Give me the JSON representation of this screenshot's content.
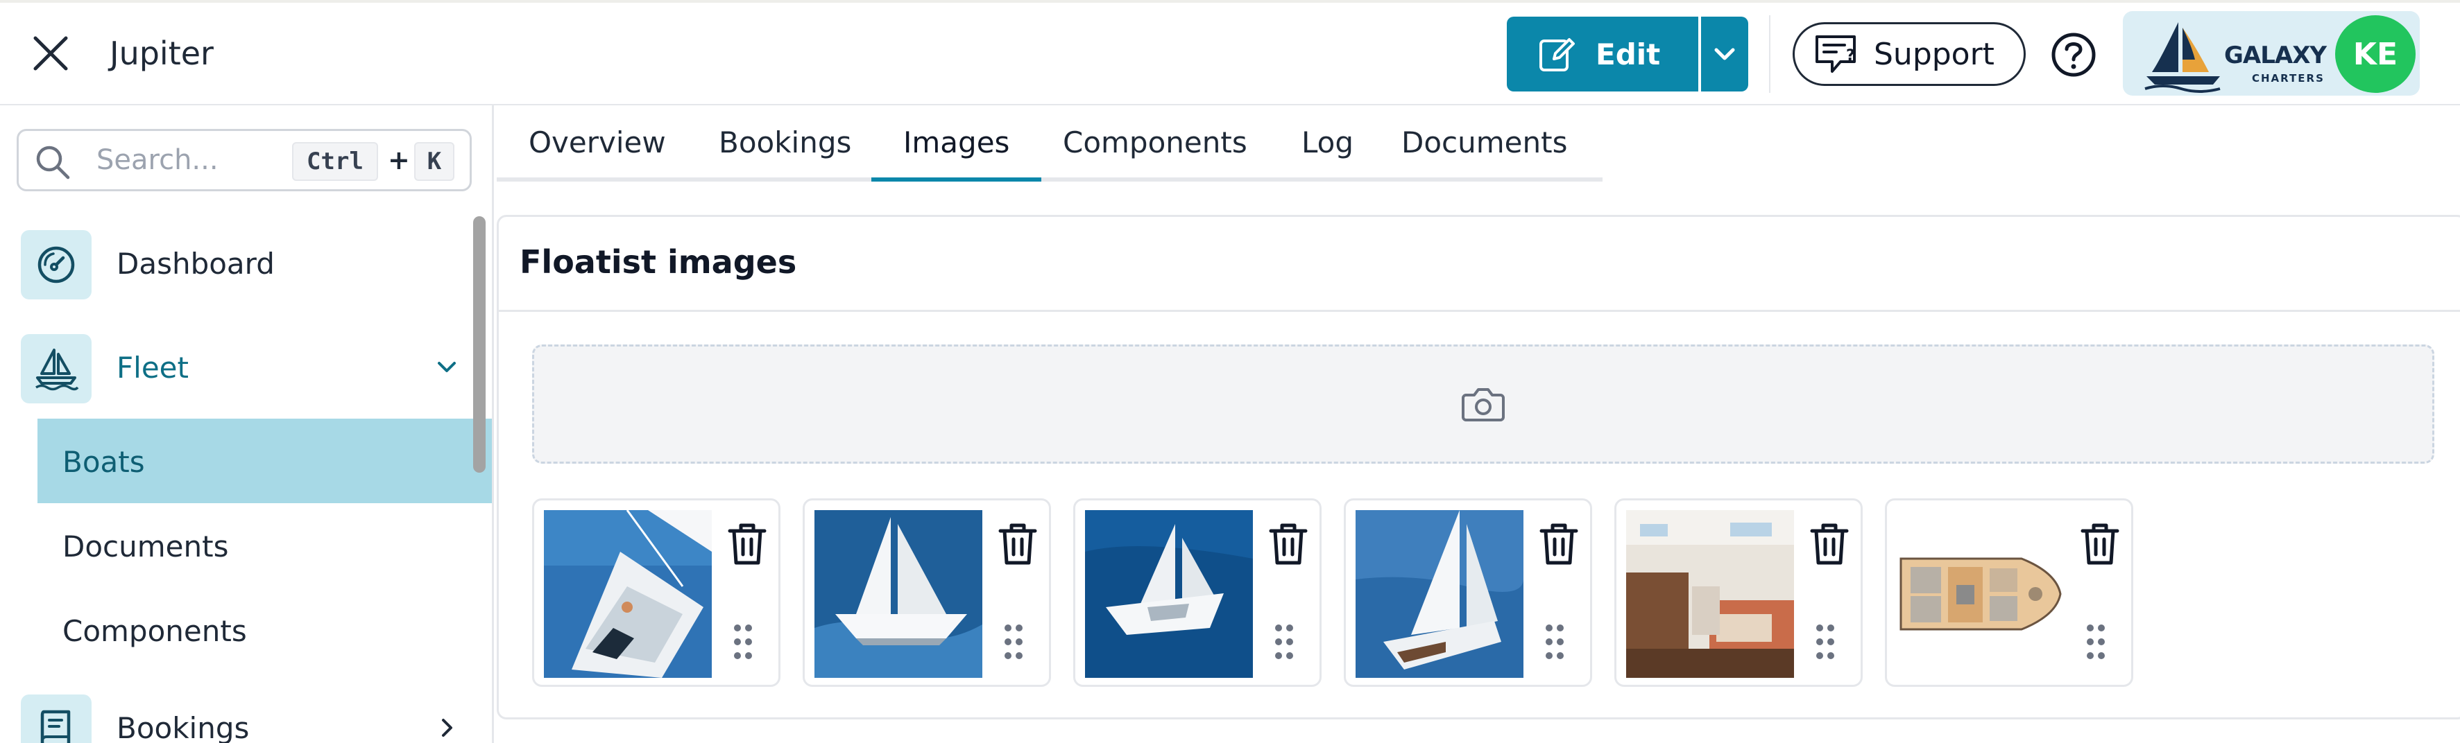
{
  "header": {
    "title": "Jupiter",
    "edit_label": "Edit",
    "support_label": "Support",
    "brand": {
      "name": "GALAXY",
      "sub": "CHARTERS"
    },
    "avatar_initials": "KE"
  },
  "sidebar": {
    "search": {
      "placeholder": "Search...",
      "shortcut_ctrl": "Ctrl",
      "shortcut_plus": "+",
      "shortcut_key": "K"
    },
    "items": [
      {
        "label": "Dashboard",
        "icon": "gauge-icon"
      },
      {
        "label": "Fleet",
        "icon": "sailboat-icon",
        "expanded": true,
        "children": [
          {
            "label": "Boats",
            "active": true
          },
          {
            "label": "Documents"
          },
          {
            "label": "Components"
          }
        ]
      },
      {
        "label": "Bookings",
        "icon": "book-icon",
        "expanded": false
      }
    ]
  },
  "tabs": [
    {
      "label": "Overview"
    },
    {
      "label": "Bookings"
    },
    {
      "label": "Images",
      "active": true
    },
    {
      "label": "Components"
    },
    {
      "label": "Log"
    },
    {
      "label": "Documents"
    }
  ],
  "card": {
    "title": "Floatist images",
    "upload_icon": "camera-icon",
    "images": [
      {
        "subject": "sailboat-deck-aerial"
      },
      {
        "subject": "sailboat-sailing"
      },
      {
        "subject": "sailboat-aerial"
      },
      {
        "subject": "sailboat-heeling"
      },
      {
        "subject": "cabin-interior"
      },
      {
        "subject": "deck-plan"
      }
    ]
  },
  "colors": {
    "accent": "#0b87aa",
    "active_nav_bg": "#a7d9e6",
    "icon_tile_bg": "#d5edf3",
    "avatar_bg": "#22c55e",
    "brand_bg": "#dceef5"
  }
}
